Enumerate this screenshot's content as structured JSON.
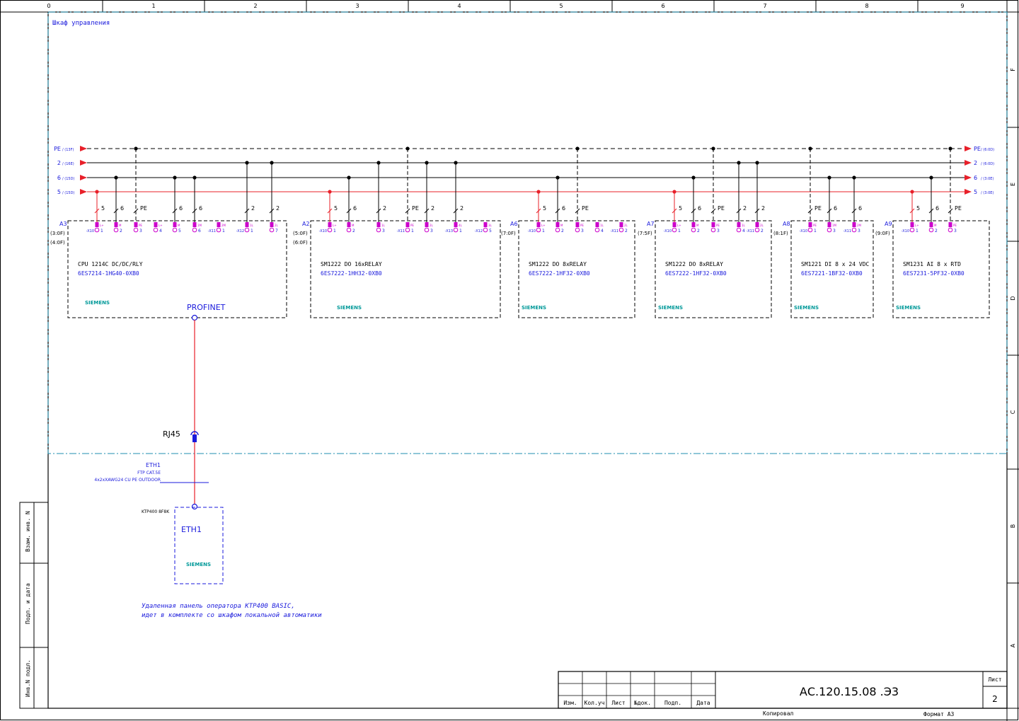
{
  "frame": {
    "columns": [
      "0",
      "1",
      "2",
      "3",
      "4",
      "5",
      "6",
      "7",
      "8",
      "9"
    ],
    "rows": [
      "F",
      "E",
      "D",
      "C",
      "B",
      "A"
    ]
  },
  "cabinet_title": "Шкаф управления",
  "rails": [
    {
      "label": "PE",
      "ref_left": "(13F)",
      "ref_right": "(6:0D)",
      "color": "#e8202a",
      "dashed": true
    },
    {
      "label": "2",
      "ref_left": "(16E)",
      "ref_right": "(6:0D)",
      "color": "#000000",
      "dashed": false
    },
    {
      "label": "6",
      "ref_left": "(15D)",
      "ref_right": "(3:0E)",
      "color": "#000000",
      "dashed": false
    },
    {
      "label": "5",
      "ref_left": "(15D)",
      "ref_right": "(3:0E)",
      "color": "#e8202a",
      "dashed": false
    }
  ],
  "modules": [
    {
      "tag": "A3",
      "refs": [
        "(3:0F)",
        "(4:0F)"
      ],
      "name": "CPU 1214C DC/DC/RLY",
      "order": "6ES7214-1HG40-0XB0",
      "brand": "SIEMENS",
      "wires": [
        "5",
        "6",
        "PE",
        "",
        "6",
        "6",
        "",
        "2",
        "2"
      ],
      "terminals": [
        {
          "conn": "-X10",
          "pin": "1",
          "sig": "L+"
        },
        {
          "conn": "",
          "pin": "2",
          "sig": "M"
        },
        {
          "conn": "",
          "pin": "3",
          "sig": "PE"
        },
        {
          "conn": "",
          "pin": "4",
          "sig": "L+"
        },
        {
          "conn": "",
          "pin": "5",
          "sig": "M"
        },
        {
          "conn": "",
          "pin": "6",
          "sig": "1M"
        },
        {
          "conn": "-X11",
          "pin": "1",
          "sig": "2M"
        },
        {
          "conn": "-X12",
          "pin": "1",
          "sig": "1L"
        },
        {
          "conn": "",
          "pin": "7",
          "sig": "2L"
        }
      ]
    },
    {
      "tag": "A2",
      "refs": [
        "(5:0F)",
        "(6:0F)"
      ],
      "name": "SM1222 DO 16xRELAY",
      "order": "6ES7222-1HH32-0XB0",
      "brand": "SIEMENS",
      "wires": [
        "5",
        "6",
        "2",
        "PE",
        "2",
        "2",
        "",
        ""
      ],
      "terminals": [
        {
          "conn": "-X10",
          "pin": "1",
          "sig": "L+"
        },
        {
          "conn": "",
          "pin": "2",
          "sig": "M"
        },
        {
          "conn": "",
          "pin": "3",
          "sig": "1L"
        },
        {
          "conn": "-X11",
          "pin": "1",
          "sig": "PE"
        },
        {
          "conn": "",
          "pin": "3",
          "sig": "2L"
        },
        {
          "conn": "-X13",
          "pin": "1",
          "sig": "4L"
        },
        {
          "conn": "-X12",
          "pin": "5",
          "sig": "3L"
        },
        {
          "conn": "",
          "pin": "",
          "sig": ""
        }
      ]
    },
    {
      "tag": "A6",
      "refs": [
        "(7:0F)"
      ],
      "name": "SM1222 DO 8xRELAY",
      "order": "6ES7222-1HF32-0XB0",
      "brand": "SIEMENS",
      "wires": [
        "5",
        "6",
        "PE",
        "",
        ""
      ],
      "terminals": [
        {
          "conn": "-X10",
          "pin": "1",
          "sig": "L+"
        },
        {
          "conn": "",
          "pin": "2",
          "sig": "M"
        },
        {
          "conn": "",
          "pin": "3",
          "sig": "PE"
        },
        {
          "conn": "",
          "pin": "4",
          "sig": "1L"
        },
        {
          "conn": "-X11",
          "pin": "2",
          "sig": "2L"
        }
      ]
    },
    {
      "tag": "A7",
      "refs": [
        "(7:5F)"
      ],
      "name": "SM1222 DO 8xRELAY",
      "order": "6ES7222-1HF32-0XB0",
      "brand": "SIEMENS",
      "wires": [
        "5",
        "6",
        "PE",
        "2",
        "2"
      ],
      "terminals": [
        {
          "conn": "-X10",
          "pin": "1",
          "sig": "L+"
        },
        {
          "conn": "",
          "pin": "2",
          "sig": "M"
        },
        {
          "conn": "",
          "pin": "3",
          "sig": "PE"
        },
        {
          "conn": "",
          "pin": "4",
          "sig": "1L"
        },
        {
          "conn": "-X11",
          "pin": "2",
          "sig": "2L"
        }
      ]
    },
    {
      "tag": "A8",
      "refs": [
        "(8:1F)"
      ],
      "name": "SM1221 DI 8 x 24 VDC",
      "order": "6ES7221-1BF32-0XB0",
      "brand": "SIEMENS",
      "wires": [
        "PE",
        "6",
        "6"
      ],
      "terminals": [
        {
          "conn": "-X10",
          "pin": "1",
          "sig": "PE"
        },
        {
          "conn": "",
          "pin": "3",
          "sig": "1M"
        },
        {
          "conn": "-X11",
          "pin": "3",
          "sig": "2M"
        }
      ]
    },
    {
      "tag": "A9",
      "refs": [
        "(9:0F)"
      ],
      "name": "SM1231 AI 8 x RTD",
      "order": "6ES7231-5PF32-0XB0",
      "brand": "SIEMENS",
      "wires": [
        "5",
        "6",
        "PE"
      ],
      "terminals": [
        {
          "conn": "-X10",
          "pin": "1",
          "sig": "L+"
        },
        {
          "conn": "",
          "pin": "2",
          "sig": "M"
        },
        {
          "conn": "",
          "pin": "3",
          "sig": "PE"
        }
      ]
    }
  ],
  "profinet_label": "PROFINET",
  "rj45_label": "RJ45",
  "cable": {
    "tag": "ETH1",
    "type": "FTP CAT.5E",
    "spec": "4x2xXAWG24 CU PE OUTDOOR"
  },
  "panel": {
    "model": "KTP400 8F8K",
    "port": "ETH1",
    "brand": "SIEMENS"
  },
  "note_lines": [
    "Удаленная панель оператора KTP400  BASIC,",
    "идет в комплекте со шкафом локальной автоматики"
  ],
  "side_stamp": [
    "Взам. инв. N",
    "Подп. и дата",
    "Инв.N подл."
  ],
  "title_block": {
    "headers": [
      "Изм.",
      "Кол.уч",
      "Лист",
      "№док.",
      "Подп.",
      "Дата"
    ],
    "doc_code": "АС.120.15.08  .Э3",
    "sheet_label": "Лист",
    "sheet_number": "2",
    "copied": "Копировал",
    "format": "Формат  А3"
  },
  "colors": {
    "frame": "#000000",
    "cabinet": "#1f8fb0",
    "text_blue": "#1a1adc",
    "red": "#e8202a",
    "magenta": "#cc00cc",
    "siemens": "#009999"
  }
}
